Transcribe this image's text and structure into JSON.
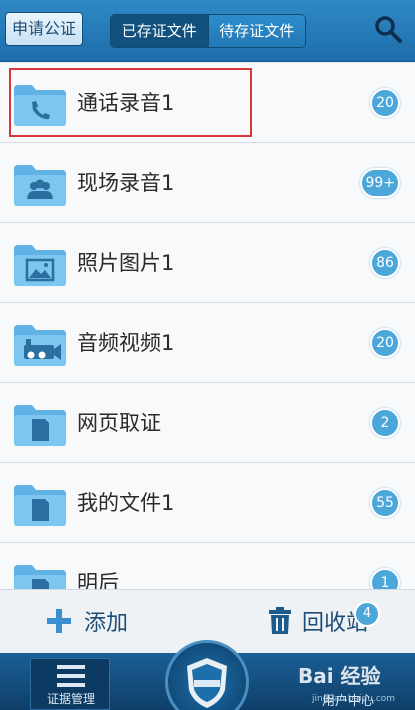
{
  "header": {
    "apply_button": "申请公证",
    "tabs": [
      {
        "label": "已存证文件",
        "active": true
      },
      {
        "label": "待存证文件",
        "active": false
      }
    ],
    "search_icon": "search-icon"
  },
  "list": {
    "items": [
      {
        "label": "通话录音1",
        "count": "20",
        "icon": "phone-folder-icon"
      },
      {
        "label": "现场录音1",
        "count": "99+",
        "icon": "people-folder-icon"
      },
      {
        "label": "照片图片1",
        "count": "86",
        "icon": "image-folder-icon"
      },
      {
        "label": "音频视频1",
        "count": "20",
        "icon": "video-folder-icon"
      },
      {
        "label": "网页取证",
        "count": "2",
        "icon": "document-folder-icon"
      },
      {
        "label": "我的文件1",
        "count": "55",
        "icon": "document-folder-icon"
      },
      {
        "label": "明后",
        "count": "1",
        "icon": "document-folder-icon"
      }
    ]
  },
  "actions": {
    "add_label": "添加",
    "recycle_label": "回收站",
    "recycle_count": "4"
  },
  "nav": {
    "left_label": "证据管理",
    "right_label": "用户中心",
    "watermark": "Bai 经验",
    "watermark_sub": "jingyan.baidu.com"
  },
  "colors": {
    "header": "#2279b6",
    "badge": "#4ba6da",
    "highlight": "#d9383a",
    "nav": "#0e3f69"
  }
}
